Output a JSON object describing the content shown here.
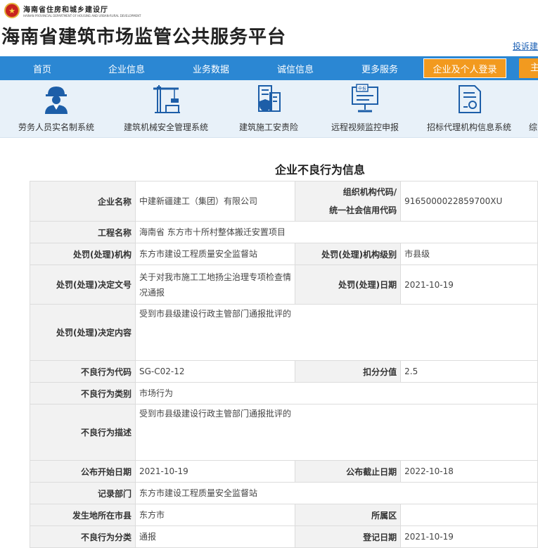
{
  "header": {
    "dept_cn": "海南省住房和城乡建设厅",
    "dept_en": "HAINAN PROVINCIAL DEPARTMENT OF HOUSING AND URBAN-RURAL DEVELOPMENT",
    "site_title": "海南省建筑市场监管公共服务平台",
    "complaint_link": "投诉建"
  },
  "nav": {
    "items": [
      "首页",
      "企业信息",
      "业务数据",
      "诚信信息",
      "更多服务"
    ],
    "login": "企业及个人登录",
    "extra": "主"
  },
  "systems": [
    {
      "label": "劳务人员实名制系统",
      "icon": "worker-icon"
    },
    {
      "label": "建筑机械安全管理系统",
      "icon": "crane-icon"
    },
    {
      "label": "建筑施工安责险",
      "icon": "shield-building-icon"
    },
    {
      "label": "远程视频监控申报",
      "icon": "monitor-report-icon"
    },
    {
      "label": "招标代理机构信息系统",
      "icon": "document-icon"
    },
    {
      "label": "综",
      "icon": "more-icon"
    }
  ],
  "page_title": "企业不良行为信息",
  "record": {
    "company_name_label": "企业名称",
    "company_name": "中建新疆建工（集团）有限公司",
    "org_code_label_1": "组织机构代码/",
    "org_code_label_2": "统一社会信用代码",
    "org_code": "9165000022859700XU",
    "project_label": "工程名称",
    "project": "海南省 东方市十所村整体搬迁安置项目",
    "agency_label": "处罚(处理)机构",
    "agency": "东方市建设工程质量安全监督站",
    "agency_level_label": "处罚(处理)机构级别",
    "agency_level": "市县级",
    "doc_no_label": "处罚(处理)决定文号",
    "doc_no": "关于对我市施工工地扬尘治理专项检查情况通报",
    "penalty_date_label": "处罚(处理)日期",
    "penalty_date": "2021-10-19",
    "decision_label": "处罚(处理)决定内容",
    "decision": "受到市县级建设行政主管部门通报批评的",
    "code_label": "不良行为代码",
    "code": "SG-C02-12",
    "score_label": "扣分分值",
    "score": "2.5",
    "category_label": "不良行为类别",
    "category": "市场行为",
    "description_label": "不良行为描述",
    "description": "受到市县级建设行政主管部门通报批评的",
    "publish_start_label": "公布开始日期",
    "publish_start": "2021-10-19",
    "publish_end_label": "公布截止日期",
    "publish_end": "2022-10-18",
    "record_dept_label": "记录部门",
    "record_dept": "东方市建设工程质量安全监督站",
    "city_label": "发生地所在市县",
    "city": "东方市",
    "district_label": "所属区",
    "district": "",
    "classification_label": "不良行为分类",
    "classification": "通报",
    "register_date_label": "登记日期",
    "register_date": "2021-10-19"
  },
  "colors": {
    "nav_bg": "#2b87d3",
    "login_bg": "#f29a1f",
    "icon_blue": "#1d5ea8",
    "strip_bg": "#e8f1f9"
  }
}
